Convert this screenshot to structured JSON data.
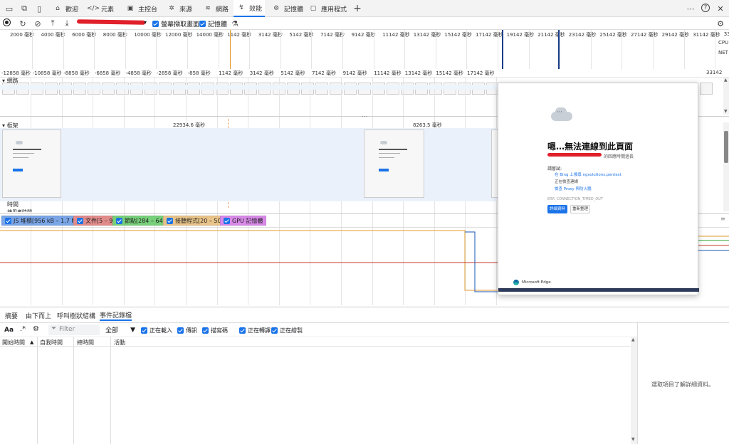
{
  "tabs": [
    {
      "label": "歡迎",
      "icon": "home-icon"
    },
    {
      "label": "元素",
      "icon": "code-icon"
    },
    {
      "label": "主控台",
      "icon": "console-icon"
    },
    {
      "label": "來源",
      "icon": "bug-icon"
    },
    {
      "label": "網路",
      "icon": "wifi-icon"
    },
    {
      "label": "效能",
      "icon": "performance-icon",
      "active": true
    },
    {
      "label": "記憶體",
      "icon": "gear-icon"
    },
    {
      "label": "應用程式",
      "icon": "window-icon"
    }
  ],
  "toolbar": {
    "screenshots_label": "螢幕擷取畫面",
    "memory_label": "記憶體"
  },
  "overview": {
    "ticks": [
      "2000 毫秒",
      "4000 毫秒",
      "6000 毫秒",
      "8000 毫秒",
      "10000 毫秒",
      "12000 毫秒",
      "14000 毫秒",
      "1142 毫秒",
      "3142 毫秒",
      "5142 毫秒",
      "7142 毫秒",
      "9142 毫秒",
      "11142 毫秒",
      "13142 毫秒",
      "15142 毫秒",
      "17142 毫秒",
      "19142 毫秒",
      "21142 毫秒",
      "23142 毫秒",
      "25142 毫秒",
      "27142 毫秒",
      "29142 毫秒",
      "31142 毫秒",
      "33"
    ],
    "cpu_label": "CPU",
    "net_label": "NET"
  },
  "ruler": {
    "ticks": [
      "-12858 毫秒",
      "-10858 毫秒",
      "-8858 毫秒",
      "-6858 毫秒",
      "-4858 毫秒",
      "-2858 毫秒",
      "-858 毫秒",
      "1142 毫秒",
      "3142 毫秒",
      "5142 毫秒",
      "7142 毫秒",
      "9142 毫秒",
      "11142 毫秒",
      "13142 毫秒",
      "15142 毫秒",
      "17142 毫秒",
      "33142"
    ]
  },
  "tracks": {
    "network_label": "網路",
    "frames_label": "框架",
    "frame_time_1": "22934.6 毫秒",
    "frame_time_2": "8263.5 毫秒",
    "interactions_label": "時間",
    "more_label": "使用者時間"
  },
  "legend": [
    {
      "label": "JS 堆積[956 kB – 1.7 MB]",
      "color": "#7aa6e8"
    },
    {
      "label": "文件[5 – 9]",
      "color": "#e28b8b"
    },
    {
      "label": "節點[284 – 647]",
      "color": "#77d07a"
    },
    {
      "label": "接聽程式[20 – 50]",
      "color": "#e9c48a"
    },
    {
      "label": "GPU 記憶體",
      "color": "#d98ae9"
    }
  ],
  "popup": {
    "title": "嗯…無法連線到此頁面",
    "subtitle": "的回應時間過長",
    "try_label": "請嘗試:",
    "bullets": [
      "在 Bing 上搜尋 ngsolutions.pentest",
      "正在檢查連線",
      "檢查 Proxy 與防火牆"
    ],
    "error_code": "ERR_CONNECTION_TIMED_OUT",
    "refresh_button": "詳細資料",
    "details_button": "重新整理",
    "brand": "Microsoft Edge"
  },
  "bottom": {
    "tabs": [
      "摘要",
      "由下而上",
      "呼叫樹狀結構",
      "事件記錄檔"
    ],
    "filter_placeholder": "Filter",
    "all_label": "全部",
    "checks": [
      "正在載入",
      "傳訊",
      "描寫碼",
      "正在轉譯",
      "正在繪製"
    ],
    "columns": [
      "開始時間",
      "自我時間",
      "總時間",
      "活動"
    ],
    "empty_detail": "選取項目了解詳細資料。"
  },
  "colors": {
    "accent": "#1a73e8",
    "js_heap_line": "#1a56b0",
    "docs_line": "#c0392b",
    "listeners_line": "#e09b2d",
    "nodes_line": "#2ca02c"
  }
}
